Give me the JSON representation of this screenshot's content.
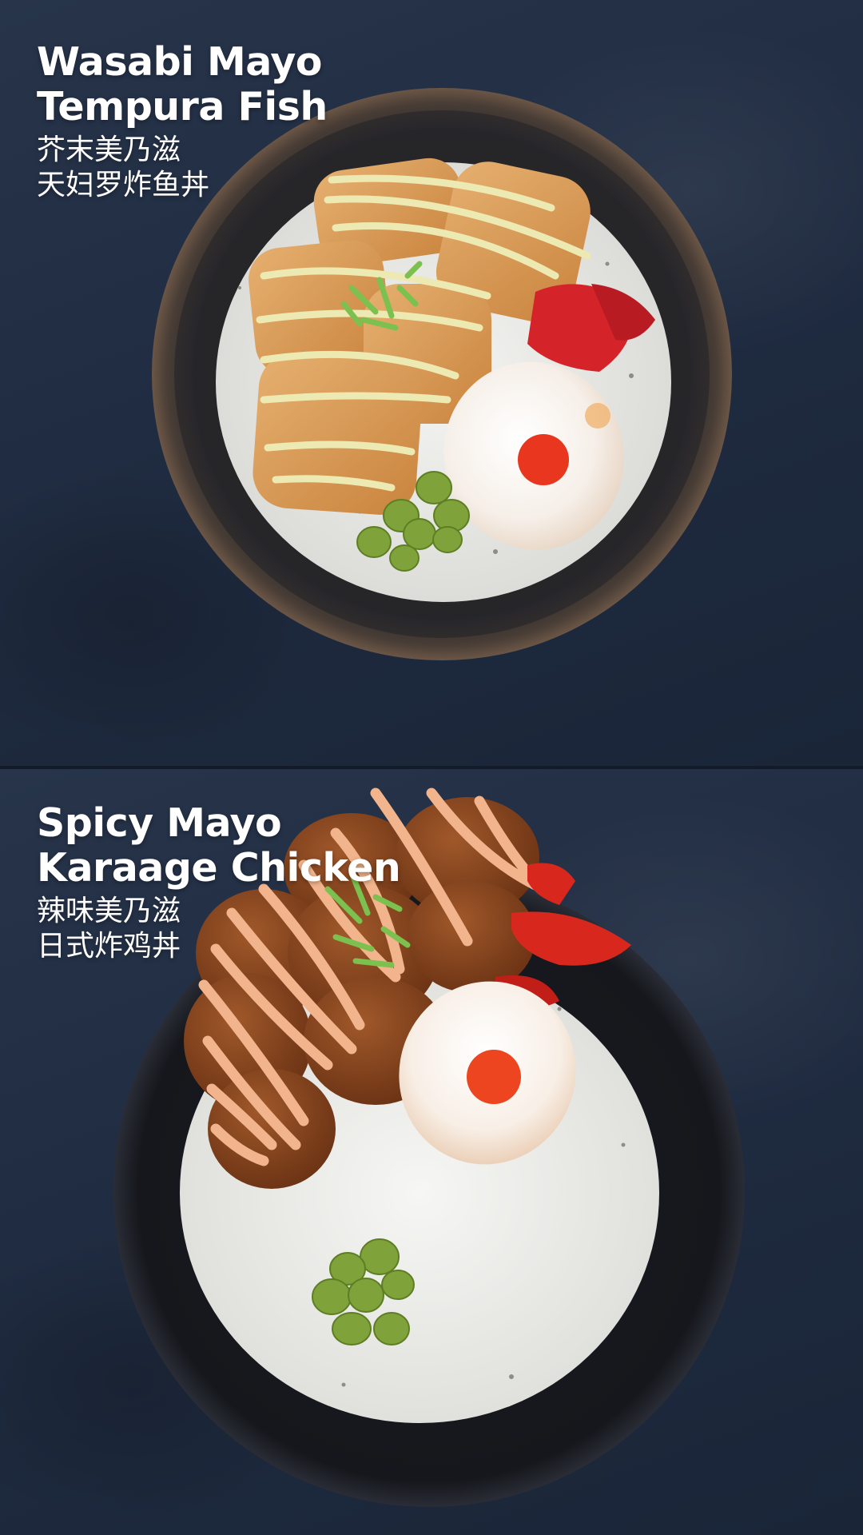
{
  "dishes": [
    {
      "title_line1": "Wasabi Mayo",
      "title_line2": "Tempura Fish",
      "cn_line1": "芥末美乃滋",
      "cn_line2": "天妇罗炸鱼丼"
    },
    {
      "title_line1": "Spicy Mayo",
      "title_line2": "Karaage Chicken",
      "cn_line1": "辣味美乃滋",
      "cn_line2": "日式炸鸡丼"
    }
  ],
  "colors": {
    "background": "#1f2b40",
    "text": "#ffffff",
    "wasabi_mayo": "#ece9b2",
    "spicy_mayo": "#f2b48c"
  }
}
